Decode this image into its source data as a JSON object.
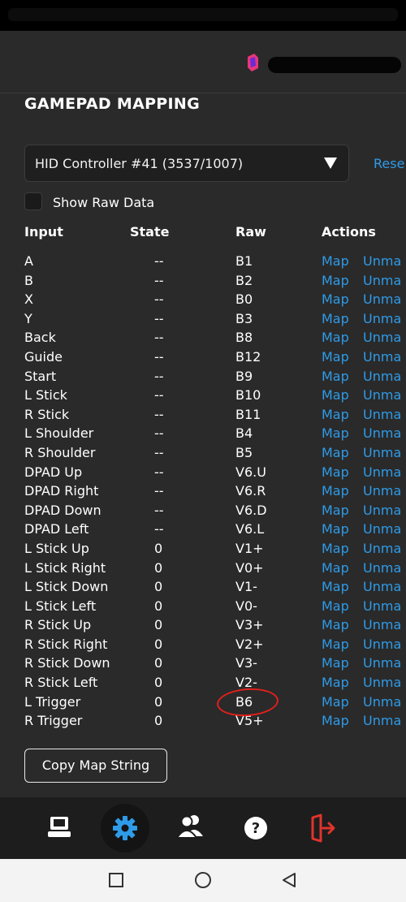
{
  "page": {
    "title": "GAMEPAD MAPPING"
  },
  "controller_select": {
    "value": "HID Controller #41 (3537/1007)"
  },
  "reset_label": "Rese",
  "show_raw": {
    "label": "Show Raw Data",
    "checked": false
  },
  "table": {
    "headers": [
      "Input",
      "State",
      "Raw",
      "Actions"
    ],
    "rows": [
      {
        "input": "A",
        "state": "--",
        "raw": "B1",
        "map": "Map",
        "unmap": "Unma"
      },
      {
        "input": "B",
        "state": "--",
        "raw": "B2",
        "map": "Map",
        "unmap": "Unma"
      },
      {
        "input": "X",
        "state": "--",
        "raw": "B0",
        "map": "Map",
        "unmap": "Unma"
      },
      {
        "input": "Y",
        "state": "--",
        "raw": "B3",
        "map": "Map",
        "unmap": "Unma"
      },
      {
        "input": "Back",
        "state": "--",
        "raw": "B8",
        "map": "Map",
        "unmap": "Unma"
      },
      {
        "input": "Guide",
        "state": "--",
        "raw": "B12",
        "map": "Map",
        "unmap": "Unma"
      },
      {
        "input": "Start",
        "state": "--",
        "raw": "B9",
        "map": "Map",
        "unmap": "Unma"
      },
      {
        "input": "L Stick",
        "state": "--",
        "raw": "B10",
        "map": "Map",
        "unmap": "Unma"
      },
      {
        "input": "R Stick",
        "state": "--",
        "raw": "B11",
        "map": "Map",
        "unmap": "Unma"
      },
      {
        "input": "L Shoulder",
        "state": "--",
        "raw": "B4",
        "map": "Map",
        "unmap": "Unma"
      },
      {
        "input": "R Shoulder",
        "state": "--",
        "raw": "B5",
        "map": "Map",
        "unmap": "Unma"
      },
      {
        "input": "DPAD Up",
        "state": "--",
        "raw": "V6.U",
        "map": "Map",
        "unmap": "Unma"
      },
      {
        "input": "DPAD Right",
        "state": "--",
        "raw": "V6.R",
        "map": "Map",
        "unmap": "Unma"
      },
      {
        "input": "DPAD Down",
        "state": "--",
        "raw": "V6.D",
        "map": "Map",
        "unmap": "Unma"
      },
      {
        "input": "DPAD Left",
        "state": "--",
        "raw": "V6.L",
        "map": "Map",
        "unmap": "Unma"
      },
      {
        "input": "L Stick Up",
        "state": "0",
        "raw": "V1+",
        "map": "Map",
        "unmap": "Unma"
      },
      {
        "input": "L Stick Right",
        "state": "0",
        "raw": "V0+",
        "map": "Map",
        "unmap": "Unma"
      },
      {
        "input": "L Stick Down",
        "state": "0",
        "raw": "V1-",
        "map": "Map",
        "unmap": "Unma"
      },
      {
        "input": "L Stick Left",
        "state": "0",
        "raw": "V0-",
        "map": "Map",
        "unmap": "Unma"
      },
      {
        "input": "R Stick Up",
        "state": "0",
        "raw": "V3+",
        "map": "Map",
        "unmap": "Unma"
      },
      {
        "input": "R Stick Right",
        "state": "0",
        "raw": "V2+",
        "map": "Map",
        "unmap": "Unma"
      },
      {
        "input": "R Stick Down",
        "state": "0",
        "raw": "V3-",
        "map": "Map",
        "unmap": "Unma"
      },
      {
        "input": "R Stick Left",
        "state": "0",
        "raw": "V2-",
        "map": "Map",
        "unmap": "Unma"
      },
      {
        "input": "L Trigger",
        "state": "0",
        "raw": "B6",
        "map": "Map",
        "unmap": "Unma"
      },
      {
        "input": "R Trigger",
        "state": "0",
        "raw": "V5+",
        "map": "Map",
        "unmap": "Unma"
      }
    ]
  },
  "copy_button": "Copy Map String",
  "bottom_nav": {
    "items": [
      {
        "icon": "computer-icon"
      },
      {
        "icon": "gear-icon",
        "active": true
      },
      {
        "icon": "users-icon"
      },
      {
        "icon": "help-icon"
      },
      {
        "icon": "logout-icon"
      }
    ]
  },
  "colors": {
    "accent": "#2e9be8",
    "background": "#2a2a2a",
    "logout": "#e0342c",
    "annotation": "#e0201c"
  },
  "system_nav": {
    "items": [
      "recents-square-icon",
      "home-circle-icon",
      "back-triangle-icon"
    ]
  }
}
